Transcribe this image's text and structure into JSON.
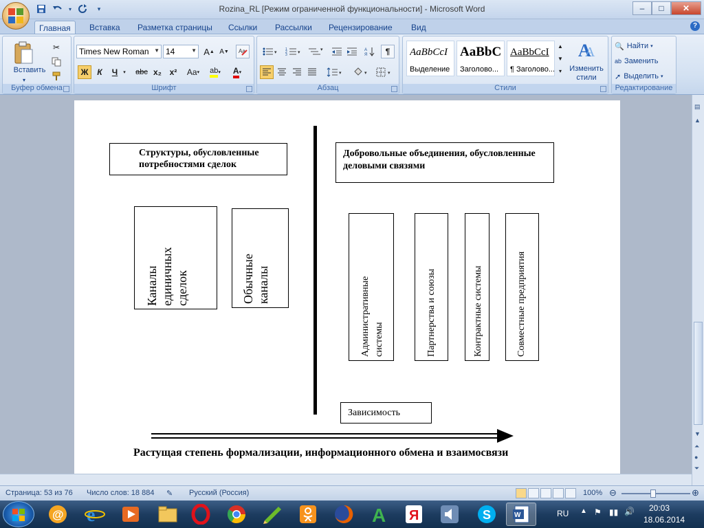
{
  "window": {
    "title": "Rozina_RL [Режим ограниченной функциональности] - Microsoft Word",
    "controls": {
      "minimize": "–",
      "maximize": "□",
      "close": "✕"
    }
  },
  "quick_access": {
    "save_icon": "save-icon",
    "undo_icon": "undo-icon",
    "redo_icon": "redo-icon",
    "customize": "▾"
  },
  "tabs": [
    {
      "label": "Главная",
      "active": true
    },
    {
      "label": "Вставка"
    },
    {
      "label": "Разметка страницы"
    },
    {
      "label": "Ссылки"
    },
    {
      "label": "Рассылки"
    },
    {
      "label": "Рецензирование"
    },
    {
      "label": "Вид"
    }
  ],
  "ribbon": {
    "clipboard": {
      "label": "Буфер обмена",
      "paste": "Вставить"
    },
    "font": {
      "label": "Шрифт",
      "font_name": "Times New Roman",
      "font_size": "14",
      "grow": "A",
      "shrink": "A",
      "bold": "Ж",
      "italic": "К",
      "underline": "Ч",
      "strike": "abc",
      "subscript": "x₂",
      "superscript": "x²",
      "change_case": "Aa",
      "highlight": "ab",
      "font_color": "A"
    },
    "paragraph": {
      "label": "Абзац",
      "show_marks": "¶"
    },
    "styles": {
      "label": "Стили",
      "items": [
        {
          "sample": "AaBbCcI",
          "name": "Выделение"
        },
        {
          "sample": "AaBbC",
          "name": "Заголово..."
        },
        {
          "sample": "AaBbCcI",
          "name": "¶ Заголово..."
        }
      ],
      "change_styles_1": "Изменить",
      "change_styles_2": "стили"
    },
    "editing": {
      "label": "Редактирование",
      "find": "Найти",
      "replace": "Заменить",
      "select": "Выделить"
    }
  },
  "document": {
    "left_header": "Структуры, обусловленные потребностями сделок",
    "right_header": "Добровольные объединения, обусловленные деловыми связями",
    "left_boxes": [
      "Каналы\nединичных\nсделок",
      "Обычные\nканалы"
    ],
    "right_boxes": [
      "Административные\nсистемы",
      "Партнерства и союзы",
      "Контрактные системы",
      "Совместные предприятия"
    ],
    "dependency": "Зависимость",
    "caption": "Растущая степень формализации, информационного обмена и взаимосвязи"
  },
  "status": {
    "page": "Страница: 53 из 76",
    "words": "Число слов: 18 884",
    "language": "Русский (Россия)",
    "zoom": "100%"
  },
  "taskbar": {
    "lang": "RU",
    "time": "20:03",
    "date": "18.06.2014"
  }
}
